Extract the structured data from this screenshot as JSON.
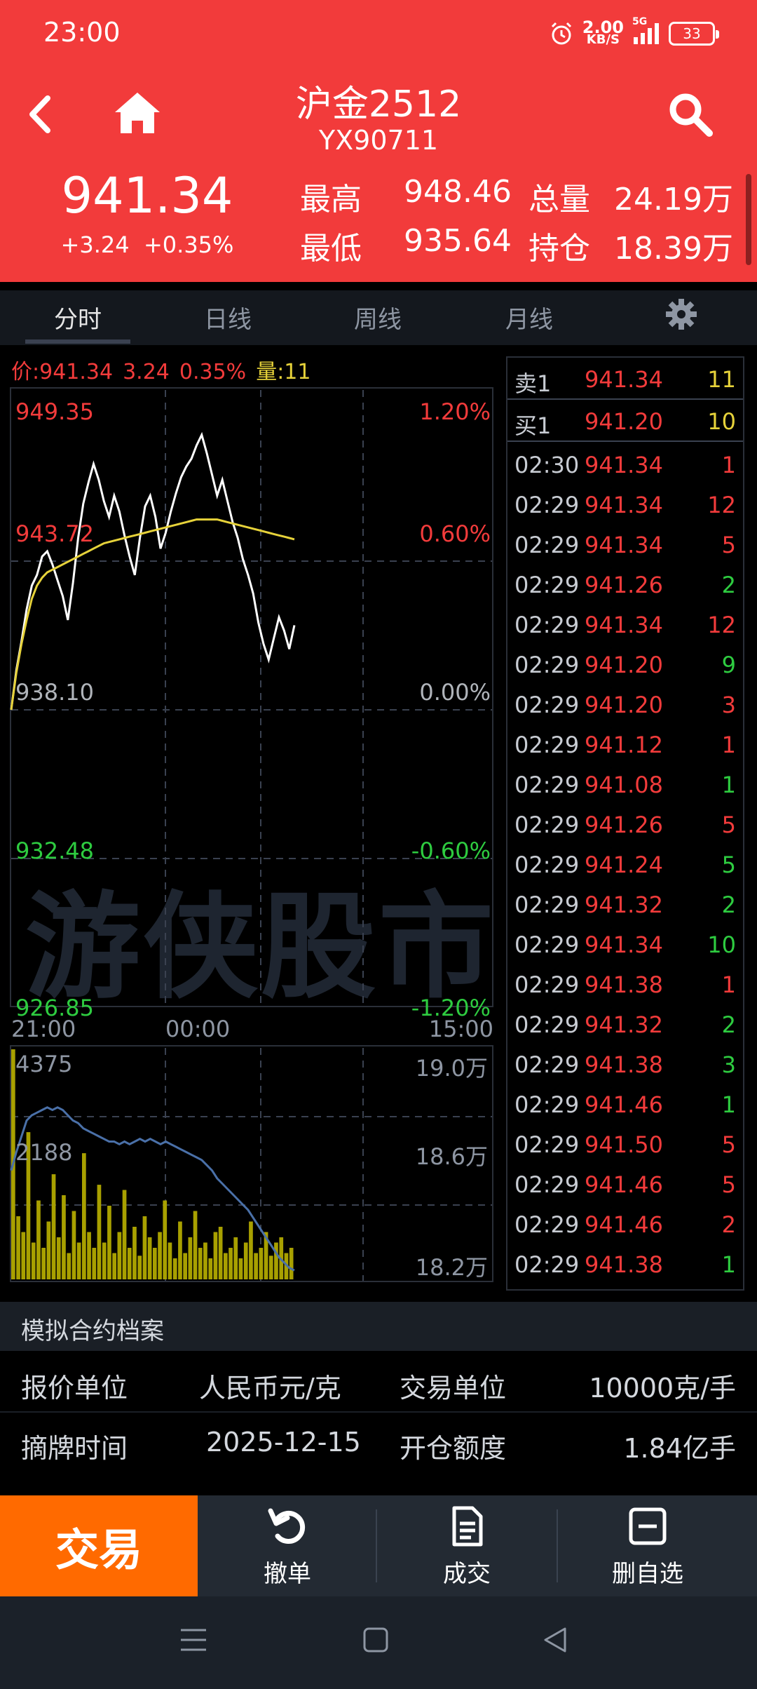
{
  "status": {
    "time": "23:00",
    "net_speed": "2.00",
    "net_unit": "KB/S",
    "signal": "5G",
    "battery": "33"
  },
  "header": {
    "title": "沪金2512",
    "code": "YX90711",
    "price": "941.34",
    "change": "+3.24",
    "change_pct": "+0.35%",
    "high_label": "最高",
    "high": "948.46",
    "low_label": "最低",
    "low": "935.64",
    "volume_label": "总量",
    "volume": "24.19万",
    "oi_label": "持仓",
    "oi": "18.39万"
  },
  "tabs": [
    {
      "label": "分时",
      "active": true
    },
    {
      "label": "日线",
      "active": false
    },
    {
      "label": "周线",
      "active": false
    },
    {
      "label": "月线",
      "active": false
    }
  ],
  "chart_info": {
    "price_label": "价:941.34",
    "change": "3.24",
    "pct": "0.35%",
    "vol_label": "量",
    "vol": ":11"
  },
  "chart_axis": {
    "prices": [
      "949.35",
      "943.72",
      "938.10",
      "932.48",
      "926.85"
    ],
    "pcts": [
      "1.20%",
      "0.60%",
      "0.00%",
      "-0.60%",
      "-1.20%"
    ],
    "times": [
      "21:00",
      "00:00",
      "15:00"
    ],
    "vol_left": [
      "4375",
      "2188"
    ],
    "vol_right": [
      "19.0万",
      "18.6万",
      "18.2万"
    ]
  },
  "watermark": "游侠股市",
  "chart_data": {
    "type": "line",
    "series": [
      {
        "values": [
          938.1,
          939.6,
          940.7,
          941.9,
          942.8,
          943.2,
          943.9,
          944.1,
          943.6,
          943.0,
          942.4,
          941.5,
          942.9,
          944.6,
          945.9,
          946.7,
          947.4,
          946.8,
          946.0,
          945.4,
          946.2,
          945.6,
          944.7,
          943.9,
          943.2,
          944.6,
          945.8,
          946.2,
          945.4,
          944.2,
          944.8,
          945.6,
          946.3,
          946.9,
          947.3,
          947.6,
          948.1,
          948.5,
          947.8,
          947.0,
          946.2,
          946.8,
          946.0,
          945.2,
          944.6,
          943.8,
          943.2,
          942.5,
          941.4,
          940.6,
          940.0,
          940.8,
          941.6,
          941.1,
          940.4,
          941.3
        ]
      },
      {
        "values": [
          938.1,
          939.5,
          940.6,
          941.5,
          942.3,
          942.8,
          943.1,
          943.3,
          943.4,
          943.5,
          943.6,
          943.7,
          943.8,
          943.9,
          944.0,
          944.1,
          944.2,
          944.3,
          944.4,
          944.45,
          944.5,
          944.55,
          944.6,
          944.65,
          944.7,
          944.75,
          944.8,
          944.85,
          944.9,
          944.95,
          945.0,
          945.05,
          945.1,
          945.15,
          945.2,
          945.25,
          945.3,
          945.3,
          945.3,
          945.3,
          945.3,
          945.25,
          945.2,
          945.15,
          945.1,
          945.05,
          945.0,
          944.95,
          944.9,
          944.85,
          944.8,
          944.75,
          944.7,
          944.65,
          944.6,
          944.55
        ]
      }
    ],
    "ylim": [
      926.85,
      949.35
    ],
    "volume": [
      4375,
      1200,
      900,
      2800,
      700,
      1500,
      600,
      1100,
      2000,
      800,
      1600,
      500,
      1300,
      700,
      2400,
      900,
      600,
      1800,
      700,
      1400,
      500,
      900,
      1700,
      600,
      1000,
      450,
      1200,
      800,
      600,
      900,
      1500,
      700,
      400,
      1100,
      500,
      800,
      1300,
      600,
      700,
      400,
      900,
      1000,
      500,
      600,
      800,
      400,
      700,
      1100,
      500,
      600,
      900,
      450,
      700,
      800,
      500,
      600
    ],
    "open_interest": [
      18.55,
      18.62,
      18.68,
      18.74,
      18.76,
      18.77,
      18.78,
      18.79,
      18.78,
      18.79,
      18.78,
      18.76,
      18.74,
      18.73,
      18.71,
      18.7,
      18.69,
      18.68,
      18.67,
      18.66,
      18.66,
      18.65,
      18.66,
      18.65,
      18.66,
      18.67,
      18.66,
      18.67,
      18.66,
      18.65,
      18.66,
      18.65,
      18.64,
      18.63,
      18.62,
      18.61,
      18.6,
      18.59,
      18.57,
      18.55,
      18.52,
      18.5,
      18.48,
      18.46,
      18.44,
      18.42,
      18.4,
      18.37,
      18.34,
      18.31,
      18.28,
      18.25,
      18.22,
      18.2,
      18.18,
      18.17
    ],
    "oi_ylim": [
      18.2,
      19.0
    ],
    "vol_ylim": [
      0,
      4375
    ]
  },
  "order_book": {
    "asks": [
      {
        "label": "卖1",
        "price": "941.34",
        "vol": "11"
      }
    ],
    "bids": [
      {
        "label": "买1",
        "price": "941.20",
        "vol": "10"
      }
    ],
    "trades": [
      {
        "time": "02:30",
        "price": "941.34",
        "vol": "1",
        "side": "buy"
      },
      {
        "time": "02:29",
        "price": "941.34",
        "vol": "12",
        "side": "buy"
      },
      {
        "time": "02:29",
        "price": "941.34",
        "vol": "5",
        "side": "buy"
      },
      {
        "time": "02:29",
        "price": "941.26",
        "vol": "2",
        "side": "sell"
      },
      {
        "time": "02:29",
        "price": "941.34",
        "vol": "12",
        "side": "buy"
      },
      {
        "time": "02:29",
        "price": "941.20",
        "vol": "9",
        "side": "sell"
      },
      {
        "time": "02:29",
        "price": "941.20",
        "vol": "3",
        "side": "buy"
      },
      {
        "time": "02:29",
        "price": "941.12",
        "vol": "1",
        "side": "buy"
      },
      {
        "time": "02:29",
        "price": "941.08",
        "vol": "1",
        "side": "sell"
      },
      {
        "time": "02:29",
        "price": "941.26",
        "vol": "5",
        "side": "buy"
      },
      {
        "time": "02:29",
        "price": "941.24",
        "vol": "5",
        "side": "sell"
      },
      {
        "time": "02:29",
        "price": "941.32",
        "vol": "2",
        "side": "sell"
      },
      {
        "time": "02:29",
        "price": "941.34",
        "vol": "10",
        "side": "sell"
      },
      {
        "time": "02:29",
        "price": "941.38",
        "vol": "1",
        "side": "buy"
      },
      {
        "time": "02:29",
        "price": "941.32",
        "vol": "2",
        "side": "sell"
      },
      {
        "time": "02:29",
        "price": "941.38",
        "vol": "3",
        "side": "sell"
      },
      {
        "time": "02:29",
        "price": "941.46",
        "vol": "1",
        "side": "sell"
      },
      {
        "time": "02:29",
        "price": "941.50",
        "vol": "5",
        "side": "buy"
      },
      {
        "time": "02:29",
        "price": "941.46",
        "vol": "5",
        "side": "buy"
      },
      {
        "time": "02:29",
        "price": "941.46",
        "vol": "2",
        "side": "buy"
      },
      {
        "time": "02:29",
        "price": "941.38",
        "vol": "1",
        "side": "sell"
      }
    ]
  },
  "contract": {
    "header": "模拟合约档案",
    "rows": [
      {
        "k1": "报价单位",
        "v1": "人民币元/克",
        "k2": "交易单位",
        "v2": "10000克/手"
      },
      {
        "k1": "摘牌时间",
        "v1": "2025-12-15",
        "k2": "开仓额度",
        "v2": "1.84亿手"
      }
    ]
  },
  "bottom": {
    "trade": "交易",
    "cancel": "撤单",
    "deal": "成交",
    "remove": "删自选"
  },
  "colors": {
    "red": "#f23b3b",
    "green": "#2ecc40",
    "yellow": "#e6d23a",
    "orange": "#ff6a00",
    "volume": "#a8a000",
    "oi": "#4a70a8"
  }
}
